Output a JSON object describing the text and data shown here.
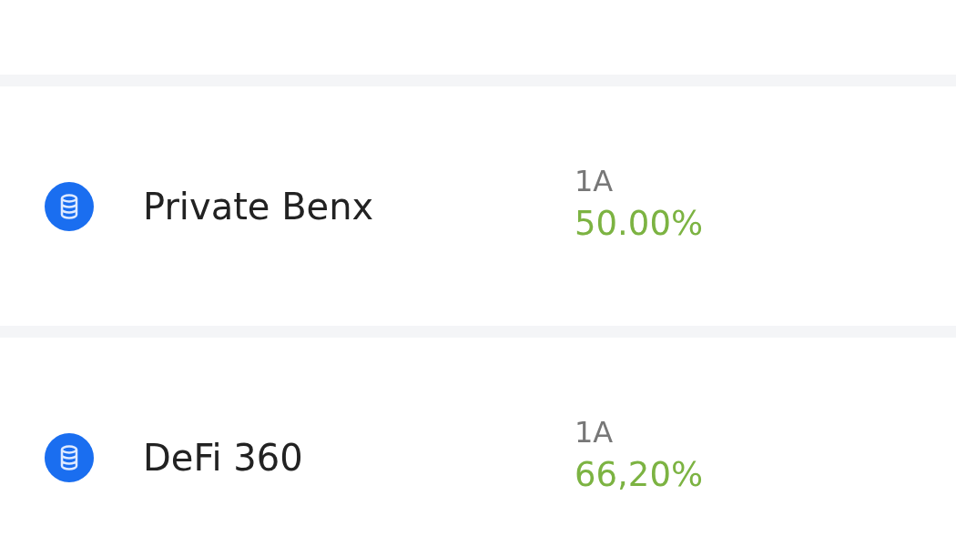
{
  "funds": [
    {
      "name": "Private Benx",
      "term": "1A",
      "rate": "50.00%"
    },
    {
      "name": "DeFi 360",
      "term": "1A",
      "rate": "66,20%"
    }
  ]
}
